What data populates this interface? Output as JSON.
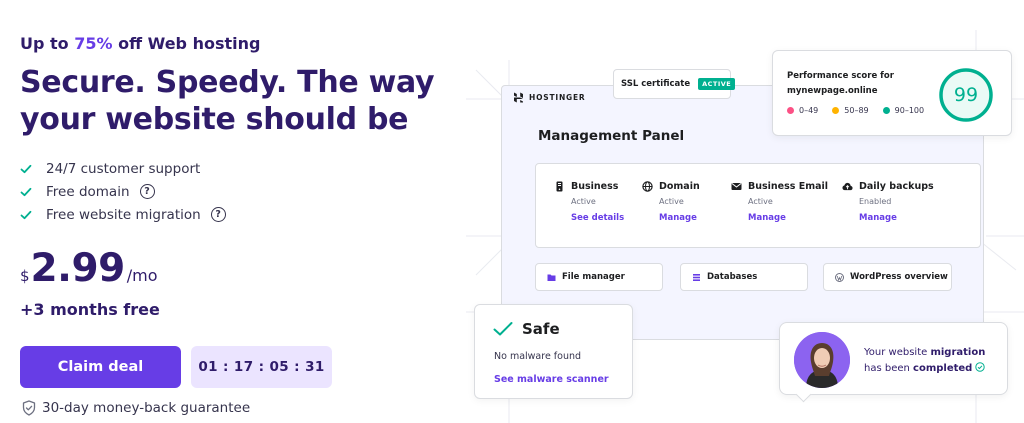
{
  "hero": {
    "promo_prefix": "Up to ",
    "promo_percent": "75%",
    "promo_suffix": " off Web hosting",
    "headline_line1": "Secure. Speedy. The way",
    "headline_line2": "your website should be",
    "features": [
      {
        "label": "24/7 customer support",
        "help": false
      },
      {
        "label": "Free domain",
        "help": true
      },
      {
        "label": "Free website migration",
        "help": true
      }
    ],
    "help_glyph": "?",
    "price": {
      "currency": "$",
      "amount": "2.99",
      "period": "/mo"
    },
    "bonus": "+3 months free",
    "cta_label": "Claim deal",
    "timer": "01 : 17 : 05 : 31",
    "guarantee": "30-day money-back guarantee"
  },
  "illustration": {
    "brand": "HOSTINGER",
    "ssl_label": "SSL certificate",
    "ssl_status": "ACTIVE",
    "panel_title": "Management Panel",
    "services": [
      {
        "name": "Business",
        "status": "Active",
        "action": "See details",
        "icon": "server-icon"
      },
      {
        "name": "Domain",
        "status": "Active",
        "action": "Manage",
        "icon": "globe-icon"
      },
      {
        "name": "Business Email",
        "status": "Active",
        "action": "Manage",
        "icon": "mail-icon"
      },
      {
        "name": "Daily backups",
        "status": "Enabled",
        "action": "Manage",
        "icon": "cloud-upload-icon"
      }
    ],
    "tools": [
      {
        "label": "File manager",
        "icon": "folder-icon"
      },
      {
        "label": "Databases",
        "icon": "database-icon"
      },
      {
        "label": "WordPress overview",
        "icon": "wordpress-icon"
      }
    ],
    "performance": {
      "label_line1": "Performance score for",
      "label_line2": "mynewpage.online",
      "score": "99",
      "legend": [
        {
          "range": "0–49",
          "color": "#fc5185"
        },
        {
          "range": "50–89",
          "color": "#ffb300"
        },
        {
          "range": "90–100",
          "color": "#00b090"
        }
      ]
    },
    "safe": {
      "title": "Safe",
      "subtitle": "No malware found",
      "link": "See malware scanner"
    },
    "migration": {
      "text1": "Your website ",
      "text1_bold": "migration",
      "text2": "has been ",
      "text2_bold": "completed"
    }
  },
  "colors": {
    "brand_purple": "#673de6",
    "dark_navy": "#2f1c6a",
    "success_green": "#00b090",
    "timer_bg": "#ebe4ff"
  }
}
